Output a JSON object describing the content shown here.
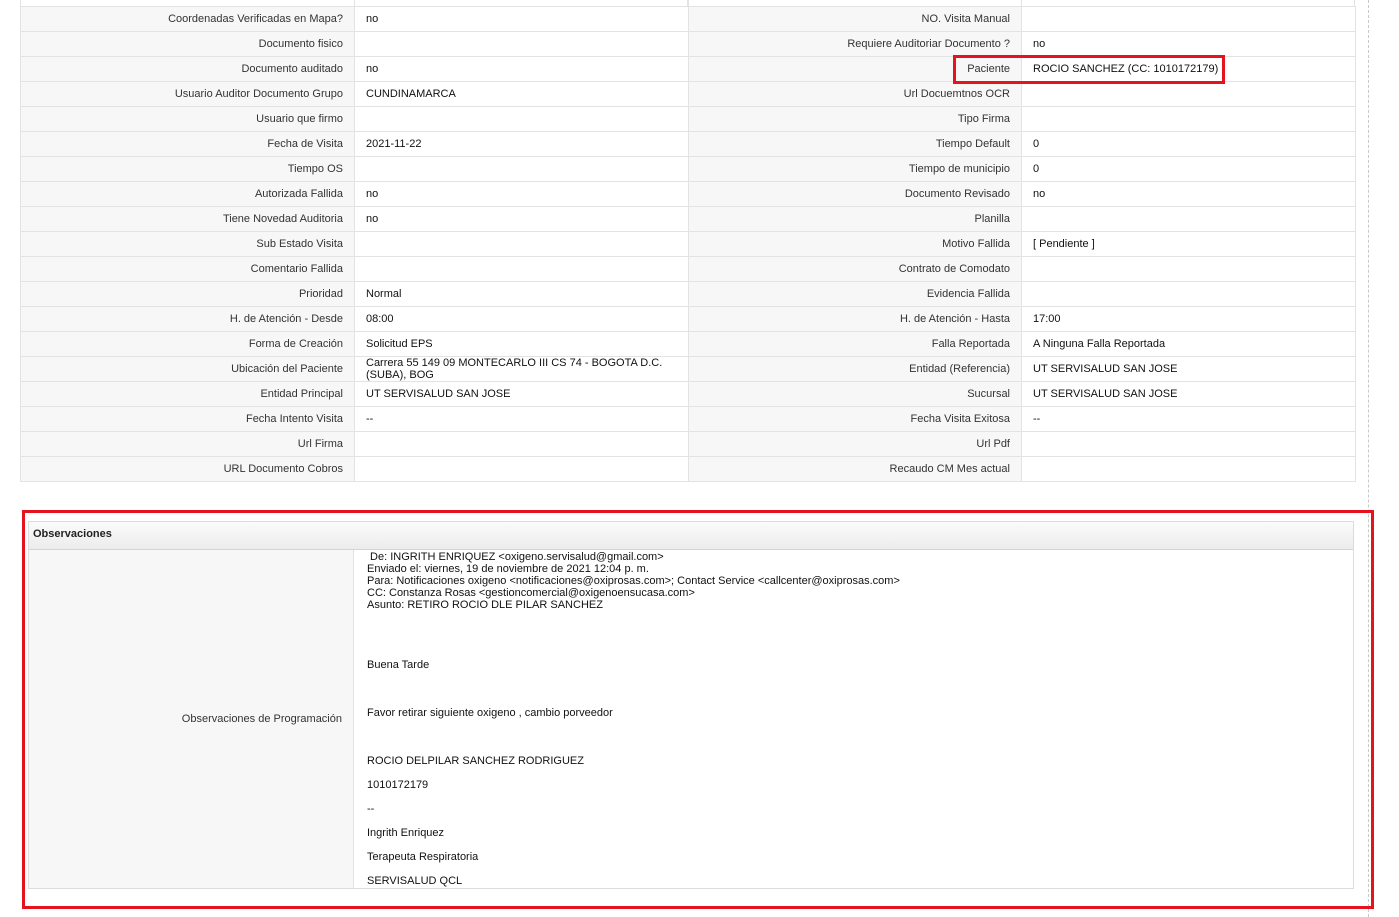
{
  "colors": {
    "highlight": "#e4131e",
    "label_bg": "#f7f7f7",
    "border": "#e3e3e3"
  },
  "rows": [
    [
      {
        "label": "Coordenadas Verificadas en Mapa?",
        "value": "no"
      },
      {
        "label": "NO. Visita Manual",
        "value": ""
      }
    ],
    [
      {
        "label": "Documento fisico",
        "value": ""
      },
      {
        "label": "Requiere Auditoriar Documento ?",
        "value": "no"
      }
    ],
    [
      {
        "label": "Documento auditado",
        "value": "no"
      },
      {
        "label": "Paciente",
        "value": "ROCIO SANCHEZ (CC: 1010172179)"
      }
    ],
    [
      {
        "label": "Usuario Auditor Documento Grupo",
        "value": "CUNDINAMARCA"
      },
      {
        "label": "Url Docuemtnos OCR",
        "value": ""
      }
    ],
    [
      {
        "label": "Usuario que firmo",
        "value": ""
      },
      {
        "label": "Tipo Firma",
        "value": ""
      }
    ],
    [
      {
        "label": "Fecha de Visita",
        "value": "2021-11-22"
      },
      {
        "label": "Tiempo Default",
        "value": "0"
      }
    ],
    [
      {
        "label": "Tiempo OS",
        "value": ""
      },
      {
        "label": "Tiempo de municipio",
        "value": "0"
      }
    ],
    [
      {
        "label": "Autorizada Fallida",
        "value": "no"
      },
      {
        "label": "Documento Revisado",
        "value": "no"
      }
    ],
    [
      {
        "label": "Tiene Novedad Auditoria",
        "value": "no"
      },
      {
        "label": "Planilla",
        "value": ""
      }
    ],
    [
      {
        "label": "Sub Estado Visita",
        "value": ""
      },
      {
        "label": "Motivo Fallida",
        "value": "[ Pendiente ]"
      }
    ],
    [
      {
        "label": "Comentario Fallida",
        "value": ""
      },
      {
        "label": "Contrato de Comodato",
        "value": ""
      }
    ],
    [
      {
        "label": "Prioridad",
        "value": "Normal"
      },
      {
        "label": "Evidencia Fallida",
        "value": ""
      }
    ],
    [
      {
        "label": "H. de Atención - Desde",
        "value": "08:00"
      },
      {
        "label": "H. de Atención - Hasta",
        "value": "17:00"
      }
    ],
    [
      {
        "label": "Forma de Creación",
        "value": "Solicitud EPS"
      },
      {
        "label": "Falla Reportada",
        "value": "A Ninguna Falla Reportada"
      }
    ],
    [
      {
        "label": "Ubicación del Paciente",
        "value": "Carrera 55 149 09 MONTECARLO III CS 74 - BOGOTA D.C. (SUBA), BOG"
      },
      {
        "label": "Entidad (Referencia)",
        "value": "UT SERVISALUD SAN JOSE"
      }
    ],
    [
      {
        "label": "Entidad Principal",
        "value": "UT SERVISALUD SAN JOSE"
      },
      {
        "label": "Sucursal",
        "value": "UT SERVISALUD SAN JOSE"
      }
    ],
    [
      {
        "label": "Fecha Intento Visita",
        "value": "--"
      },
      {
        "label": "Fecha Visita Exitosa",
        "value": "--"
      }
    ],
    [
      {
        "label": "Url Firma",
        "value": ""
      },
      {
        "label": "Url Pdf",
        "value": ""
      }
    ],
    [
      {
        "label": "URL Documento Cobros",
        "value": ""
      },
      {
        "label": "Recaudo CM Mes actual",
        "value": ""
      }
    ]
  ],
  "observaciones": {
    "title": "Observaciones",
    "label": "Observaciones de Programación",
    "lines": [
      " De: INGRITH ENRIQUEZ <oxigeno.servisalud@gmail.com>",
      "Enviado el: viernes, 19 de noviembre de 2021 12:04 p. m.",
      "Para: Notificaciones oxigeno <notificaciones@oxiprosas.com>; Contact Service <callcenter@oxiprosas.com>",
      "CC: Constanza Rosas <gestioncomercial@oxigenoensucasa.com>",
      "Asunto: RETIRO ROCIO DLE PILAR SANCHEZ",
      "Buena Tarde",
      "Favor retirar siguiente oxigeno , cambio porveedor",
      "ROCIO DELPILAR SANCHEZ RODRIGUEZ",
      "1010172179",
      "--",
      "Ingrith Enriquez",
      "Terapeuta Respiratoria",
      "SERVISALUD QCL"
    ]
  }
}
